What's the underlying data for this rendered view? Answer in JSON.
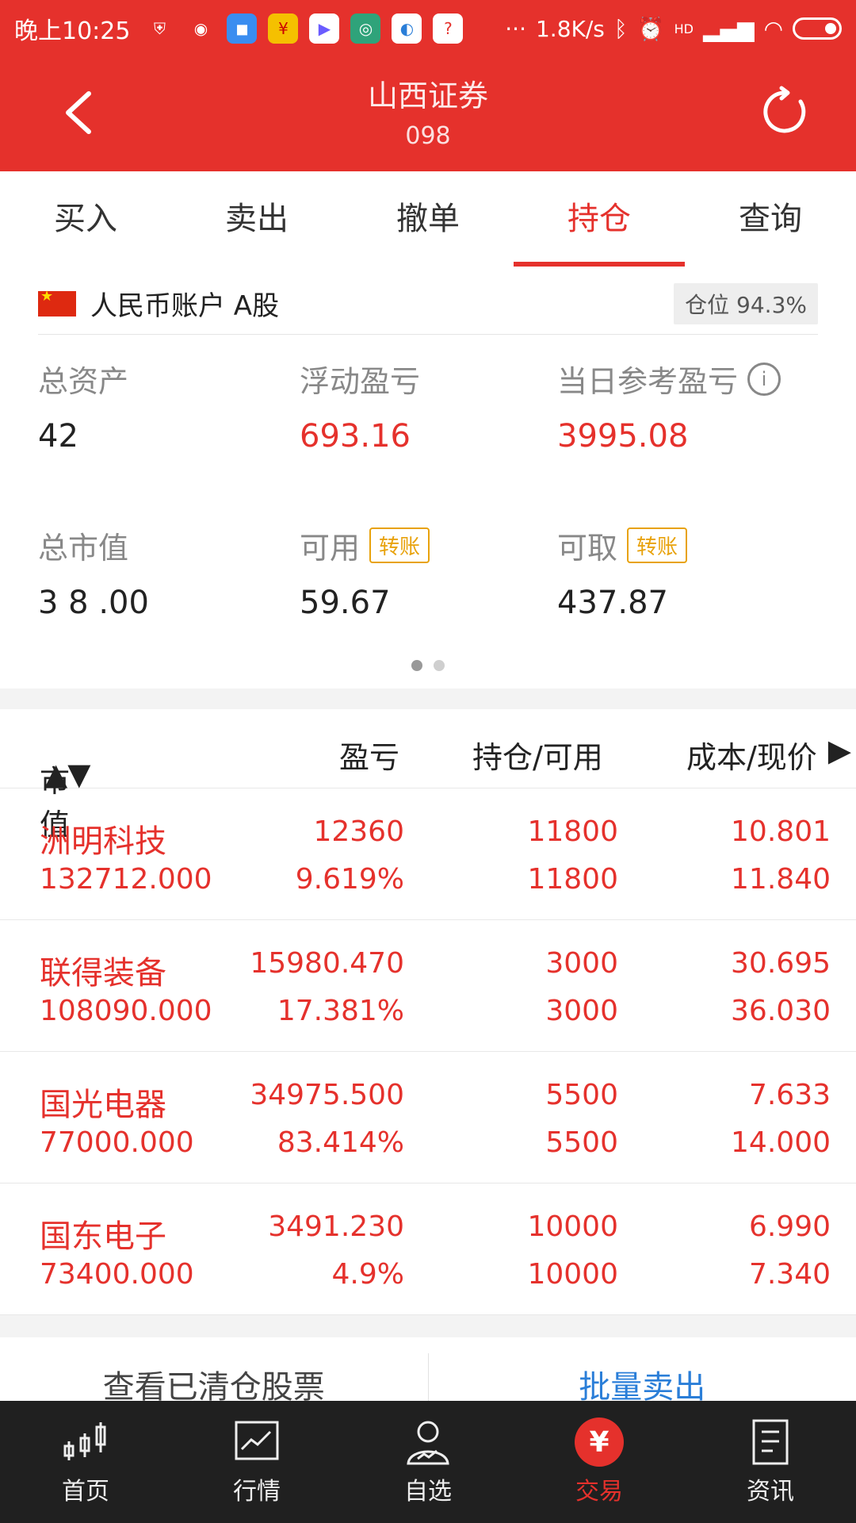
{
  "status_bar": {
    "time": "晚上10:25",
    "net_speed": "1.8K/s",
    "more": "···",
    "signal_label": "HD"
  },
  "header": {
    "title": "山西证券",
    "subtitle": "098"
  },
  "tabs": [
    {
      "label": "买入"
    },
    {
      "label": "卖出"
    },
    {
      "label": "撤单"
    },
    {
      "label": "持仓",
      "active": true
    },
    {
      "label": "查询"
    }
  ],
  "account": {
    "name": "人民币账户 A股",
    "position_ratio": "仓位 94.3%"
  },
  "summary": {
    "total_assets_label": "总资产",
    "total_assets_value": "42",
    "float_pl_label": "浮动盈亏",
    "float_pl_value": "693.16",
    "daily_pl_label": "当日参考盈亏",
    "daily_pl_value": "3995.08",
    "market_value_label": "总市值",
    "market_value_value": "3 8 .00",
    "available_label": "可用",
    "available_tag": "转账",
    "available_value": "59.67",
    "withdrawable_label": "可取",
    "withdrawable_tag": "转账",
    "withdrawable_value": "437.87"
  },
  "table": {
    "headers": {
      "market_value": "市值",
      "pl": "盈亏",
      "hold": "持仓/可用",
      "price": "成本/现价"
    },
    "rows": [
      {
        "name": "洲明科技",
        "market_value": "132712.000",
        "pl": "12360",
        "pl_pct": "9.619%",
        "hold": "11800",
        "available": "11800",
        "cost": "10.801",
        "price": "11.840"
      },
      {
        "name": "联得装备",
        "market_value": "108090.000",
        "pl": "15980.470",
        "pl_pct": "17.381%",
        "hold": "3000",
        "available": "3000",
        "cost": "30.695",
        "price": "36.030"
      },
      {
        "name": "国光电器",
        "market_value": "77000.000",
        "pl": "34975.500",
        "pl_pct": "83.414%",
        "hold": "5500",
        "available": "5500",
        "cost": "7.633",
        "price": "14.000"
      },
      {
        "name": "国东电子",
        "market_value": "73400.000",
        "pl": "3491.230",
        "pl_pct": "4.9%",
        "hold": "10000",
        "available": "10000",
        "cost": "6.990",
        "price": "7.340"
      }
    ]
  },
  "actions": {
    "view_cleared": "查看已清仓股票",
    "batch_sell": "批量卖出"
  },
  "bottom_nav": [
    {
      "label": "首页"
    },
    {
      "label": "行情"
    },
    {
      "label": "自选"
    },
    {
      "label": "交易",
      "active": true
    },
    {
      "label": "资讯"
    }
  ],
  "colors": {
    "brand_red": "#e5312c",
    "accent_blue": "#2a7ed8",
    "tag_orange": "#e8a20c",
    "nav_bg": "#202020"
  }
}
